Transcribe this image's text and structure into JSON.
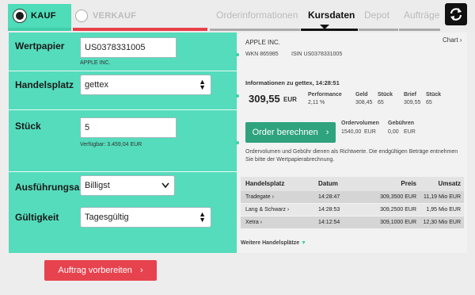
{
  "header": {
    "kauf": "KAUF",
    "verkauf": "VERKAUF",
    "tabs": [
      "Orderinformationen",
      "Kursdaten",
      "Depot",
      "Aufträge"
    ]
  },
  "form": {
    "wertpapier_label": "Wertpapier",
    "wertpapier_value": "US0378331005",
    "wertpapier_name": "APPLE INC.",
    "handelsplatz_label": "Handelsplatz",
    "handelsplatz_value": "gettex",
    "stueck_label": "Stück",
    "stueck_value": "5",
    "verfuegbar": "Verfügbar: 3.459,04 EUR",
    "ausfuehrungsart_label": "Ausführungsart",
    "ausfuehrungsart_value": "Billigst",
    "gueltigkeit_label": "Gültigkeit",
    "gueltigkeit_value": "Tagesgültig",
    "submit": "Auftrag vorbereiten"
  },
  "info": {
    "name": "APPLE INC.",
    "chart": "Chart",
    "wkn": "WKN 865985",
    "isin": "ISIN US0378331005",
    "info_title": "Informationen zu gettex, 14:28:51",
    "price": "309,55",
    "price_currency": "EUR",
    "performance_label": "Performance",
    "performance_value": "2,11 %",
    "geld_label": "Geld",
    "geld_value": "308,45",
    "geld_stueck_label": "Stück",
    "geld_stueck_value": "65",
    "brief_label": "Brief",
    "brief_value": "309,55",
    "brief_stueck_label": "Stück",
    "brief_stueck_value": "65",
    "order_button": "Order berechnen",
    "ordervolumen_label": "Ordervolumen",
    "ordervolumen_value": "1540,00",
    "ordervolumen_currency": "EUR",
    "gebuehren_label": "Gebühren",
    "gebuehren_value": "0,00",
    "gebuehren_currency": "EUR",
    "note": "Ordervolumen und Gebühr dienen als Richtwerte. Die endgültigen Beträge entnehmen Sie bitte der Wertpapierabrechnung."
  },
  "table": {
    "headers": [
      "Handelsplatz",
      "Datum",
      "Preis",
      "Umsatz"
    ],
    "rows": [
      [
        "Tradegate",
        "14:28:47",
        "309,3500 EUR",
        "11,19 Mio EUR"
      ],
      [
        "Lang & Schwarz",
        "14:28:53",
        "309,2500 EUR",
        "1,95 Mio EUR"
      ],
      [
        "Xetra",
        "14:12:54",
        "309,1000 EUR",
        "12,30 Mio EUR"
      ]
    ],
    "more": "Weitere Handelsplätze"
  },
  "colors": {
    "accent_green": "#55dcbc",
    "button_green": "#2ea37e",
    "submit_red": "#e6434f"
  }
}
